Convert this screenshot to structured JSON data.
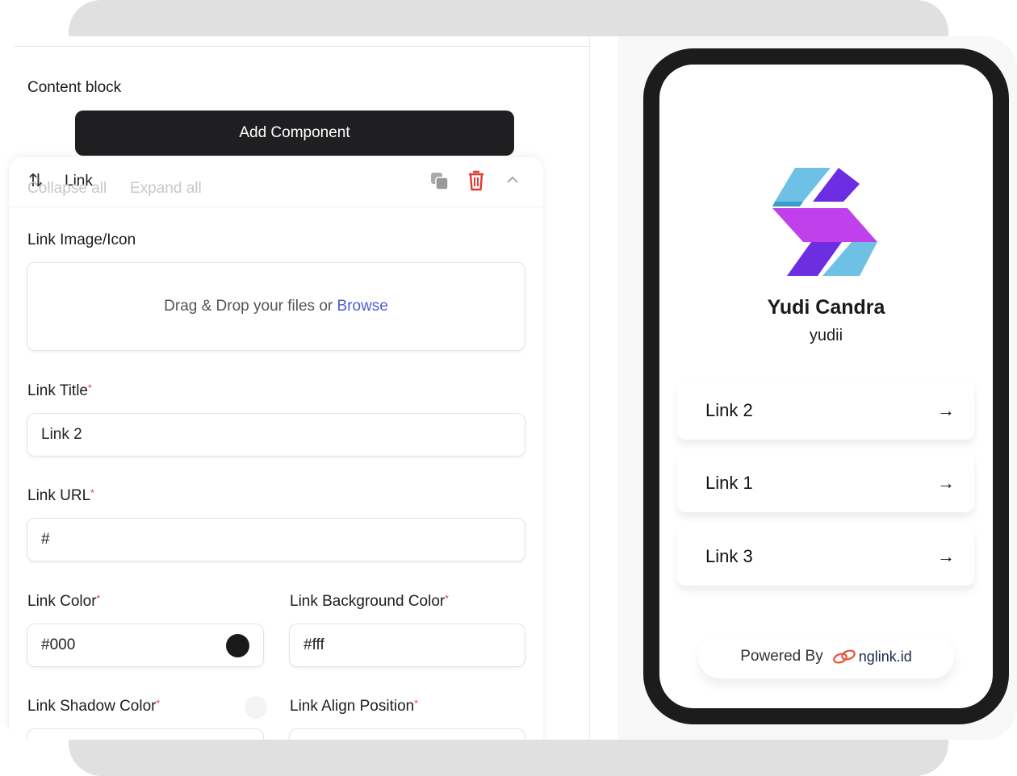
{
  "editor": {
    "section_title": "Content block",
    "add_component_label": "Add Component",
    "collapse_all": "Collapse all",
    "expand_all": "Expand all",
    "card": {
      "title": "Link",
      "image_label": "Link Image/Icon",
      "dropzone_text": "Drag & Drop your files or",
      "browse_label": "Browse",
      "title_label": "Link Title",
      "title_value": "Link 2",
      "url_label": "Link URL",
      "url_value": "#",
      "color_label": "Link Color",
      "color_value": "#000",
      "bg_color_label": "Link Background Color",
      "bg_color_value": "#fff",
      "shadow_color_label": "Link Shadow Color",
      "align_label": "Link Align Position",
      "required_mark": "*"
    }
  },
  "preview": {
    "name": "Yudi Candra",
    "username": "yudii",
    "links": [
      {
        "label": "Link 2"
      },
      {
        "label": "Link 1"
      },
      {
        "label": "Link 3"
      }
    ],
    "powered_by": "Powered By",
    "brand": "nglink.id"
  },
  "colors": {
    "browse": "#4f5bd5",
    "delete": "#e53935",
    "button": "#1f1f21",
    "swatch": "#1a1a1a"
  }
}
